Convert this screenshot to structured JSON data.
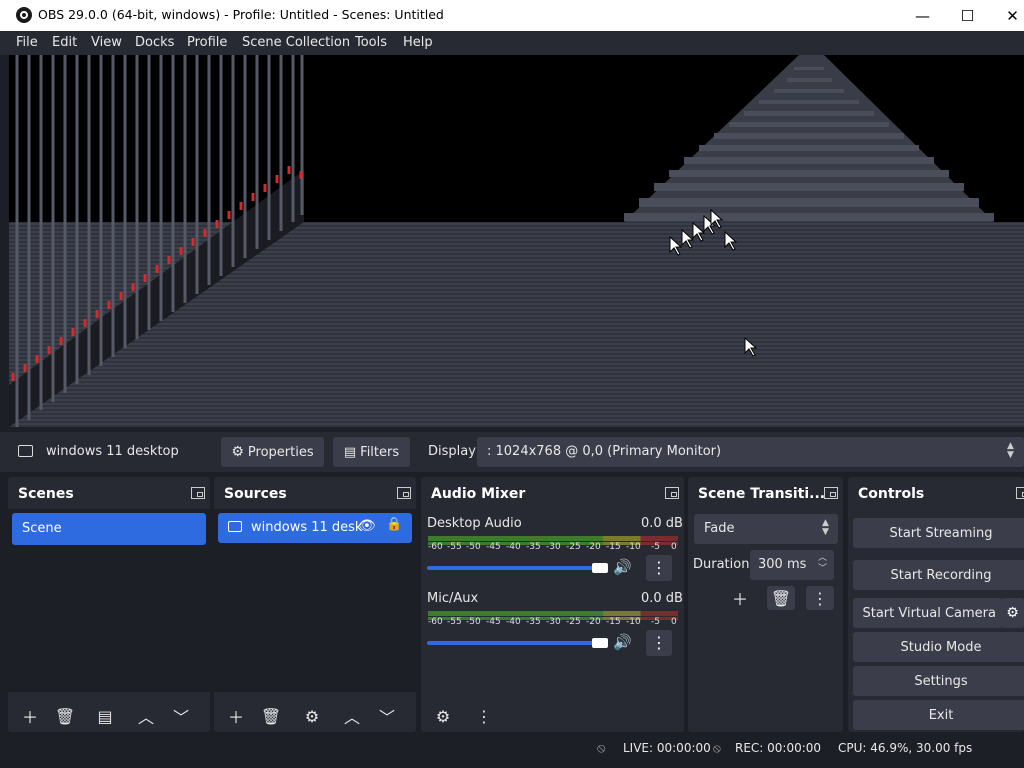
{
  "window": {
    "title": "OBS 29.0.0 (64-bit, windows) - Profile: Untitled - Scenes: Untitled",
    "minimize": "—",
    "maximize": "☐",
    "close": "✕"
  },
  "menu": [
    "File",
    "Edit",
    "View",
    "Docks",
    "Profile",
    "Scene Collection",
    "Tools",
    "Help"
  ],
  "sourcebar": {
    "selected_source": "windows 11 desktop",
    "properties": "Properties",
    "filters": "Filters",
    "display_label": "Display",
    "display_value": ": 1024x768 @ 0,0 (Primary Monitor)"
  },
  "scenes": {
    "title": "Scenes",
    "items": [
      "Scene"
    ]
  },
  "sources": {
    "title": "Sources",
    "items": [
      "windows 11 desk"
    ]
  },
  "mixer": {
    "title": "Audio Mixer",
    "ticks": [
      "-60",
      "-55",
      "-50",
      "-45",
      "-40",
      "-35",
      "-30",
      "-25",
      "-20",
      "-15",
      "-10",
      "-5",
      "0"
    ],
    "channels": [
      {
        "name": "Desktop Audio",
        "level": "0.0 dB",
        "volume": 1.0
      },
      {
        "name": "Mic/Aux",
        "level": "0.0 dB",
        "volume": 1.0
      }
    ]
  },
  "transitions": {
    "title": "Scene Transiti...",
    "selected": "Fade",
    "duration_label": "Duration",
    "duration_value": "300 ms"
  },
  "controls": {
    "title": "Controls",
    "start_streaming": "Start Streaming",
    "start_recording": "Start Recording",
    "start_virtual_camera": "Start Virtual Camera",
    "studio_mode": "Studio Mode",
    "settings": "Settings",
    "exit": "Exit"
  },
  "status": {
    "live": "LIVE: 00:00:00",
    "rec": "REC: 00:00:00",
    "cpu": "CPU: 46.9%, 30.00 fps"
  },
  "colors": {
    "accent": "#2e6ae0",
    "dock_bg": "#272a33",
    "panel_bg": "#1d1f26",
    "button_bg": "#3b3e4a"
  }
}
